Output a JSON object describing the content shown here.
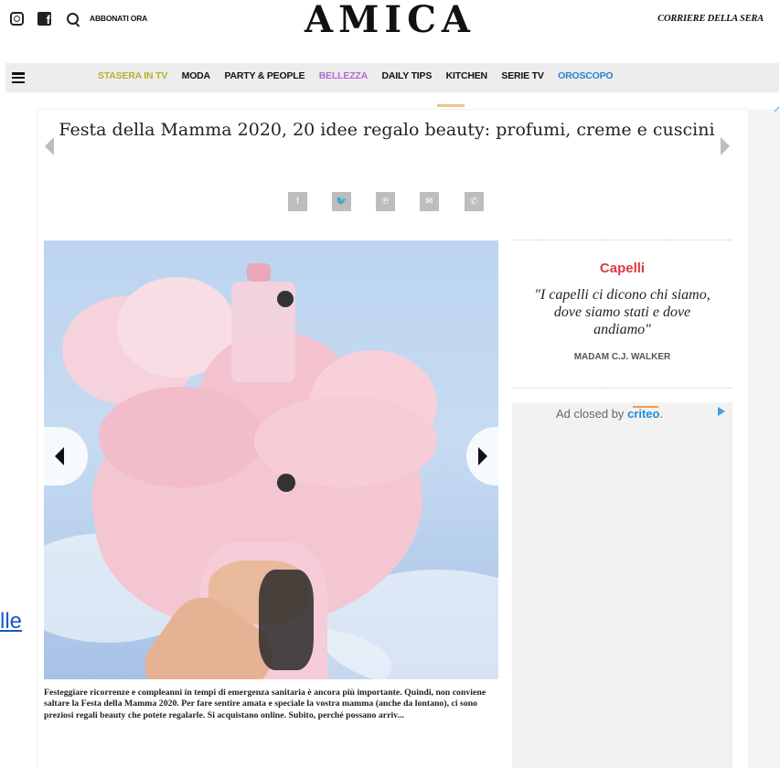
{
  "header": {
    "subscribe_label": "ABBONATI ORA",
    "logo": "AMICA",
    "partner": "CORRIERE DELLA SERA"
  },
  "nav": {
    "items": [
      {
        "label": "STASERA IN TV",
        "color": "#b9b02a"
      },
      {
        "label": "MODA",
        "color": "#111111"
      },
      {
        "label": "PARTY & PEOPLE",
        "color": "#111111"
      },
      {
        "label": "BELLEZZA",
        "color": "#b56ad1"
      },
      {
        "label": "DAILY TIPS",
        "color": "#111111"
      },
      {
        "label": "KITCHEN",
        "color": "#111111"
      },
      {
        "label": "SERIE TV",
        "color": "#111111"
      },
      {
        "label": "OROSCOPO",
        "color": "#2a7fd0"
      }
    ]
  },
  "article": {
    "title": "Festa della Mamma 2020, 20 idee regalo beauty: profumi, creme e cuscini",
    "caption": "Festeggiare ricorrenze e compleanni in tempi di emergenza sanitaria è ancora più importante. Quindi, non conviene saltare la Festa della Mamma 2020. Per fare sentire amata e speciale la vostra mamma (anche da lontano), ci sono preziosi regali beauty che potete regalarle. Si acquistano online. Subito, perché possano arriv...",
    "share_icons": [
      "facebook-icon",
      "twitter-icon",
      "pinterest-icon",
      "email-icon",
      "whatsapp-icon"
    ],
    "share_glyphs": [
      "f",
      "🐦",
      "℗",
      "✉",
      "✆"
    ]
  },
  "sidebar": {
    "quote_category": "Capelli",
    "quote": "\"I capelli ci dicono chi siamo, dove siamo stati e dove andiamo\"",
    "quote_author": "MADAM C.J. WALKER",
    "ad_label": "Ad closed by",
    "ad_brand": "criteo",
    "ad_brand_suffix": "."
  },
  "left_link": "lle"
}
